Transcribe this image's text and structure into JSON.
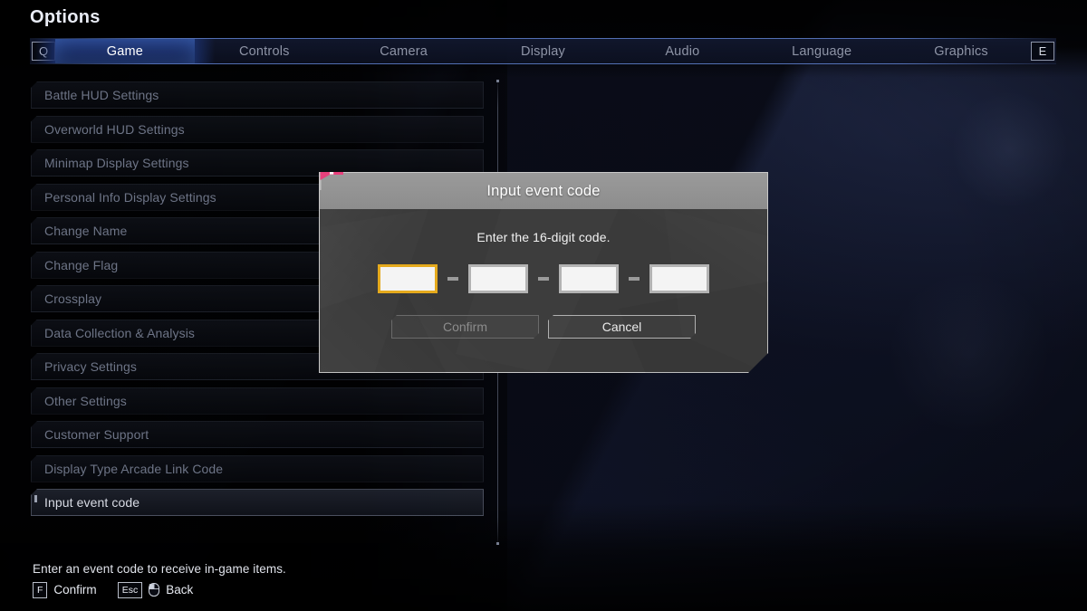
{
  "header": {
    "title": "Options",
    "left_key_hint": "Q",
    "right_key_hint": "E"
  },
  "tabs": [
    {
      "label": "Game",
      "active": true
    },
    {
      "label": "Controls",
      "active": false
    },
    {
      "label": "Camera",
      "active": false
    },
    {
      "label": "Display",
      "active": false
    },
    {
      "label": "Audio",
      "active": false
    },
    {
      "label": "Language",
      "active": false
    },
    {
      "label": "Graphics",
      "active": false
    }
  ],
  "sidebar": {
    "items": [
      {
        "label": "Battle HUD Settings",
        "selected": false
      },
      {
        "label": "Overworld HUD Settings",
        "selected": false
      },
      {
        "label": "Minimap Display Settings",
        "selected": false
      },
      {
        "label": "Personal Info Display Settings",
        "selected": false
      },
      {
        "label": "Change Name",
        "selected": false
      },
      {
        "label": "Change Flag",
        "selected": false
      },
      {
        "label": "Crossplay",
        "selected": false
      },
      {
        "label": "Data Collection & Analysis",
        "selected": false
      },
      {
        "label": "Privacy Settings",
        "selected": false
      },
      {
        "label": "Other Settings",
        "selected": false
      },
      {
        "label": "Customer Support",
        "selected": false
      },
      {
        "label": "Display Type Arcade Link Code",
        "selected": false
      },
      {
        "label": "Input event code",
        "selected": true
      }
    ]
  },
  "dialog": {
    "badge_icon": "alert-exclamation-flag",
    "title": "Input event code",
    "message": "Enter the 16-digit code.",
    "code_fields": [
      {
        "value": "",
        "focused": true
      },
      {
        "value": "",
        "focused": false
      },
      {
        "value": "",
        "focused": false
      },
      {
        "value": "",
        "focused": false
      }
    ],
    "separator": "-",
    "buttons": [
      {
        "label": "Confirm",
        "state": "disabled"
      },
      {
        "label": "Cancel",
        "state": "normal"
      }
    ]
  },
  "footer": {
    "description": "Enter an event code to receive in-game items.",
    "hints": [
      {
        "key": "F",
        "label": "Confirm",
        "icon": null
      },
      {
        "key": "Esc",
        "label": "Back",
        "icon": "mouse-icon"
      }
    ]
  },
  "colors": {
    "accent_pink": "#e8407c",
    "focus_gold": "#e5aa1d",
    "tab_active_blue": "#1a2e68",
    "dialog_body": "#3a3a3a",
    "dialog_titlebar": "#8d8d8d"
  }
}
